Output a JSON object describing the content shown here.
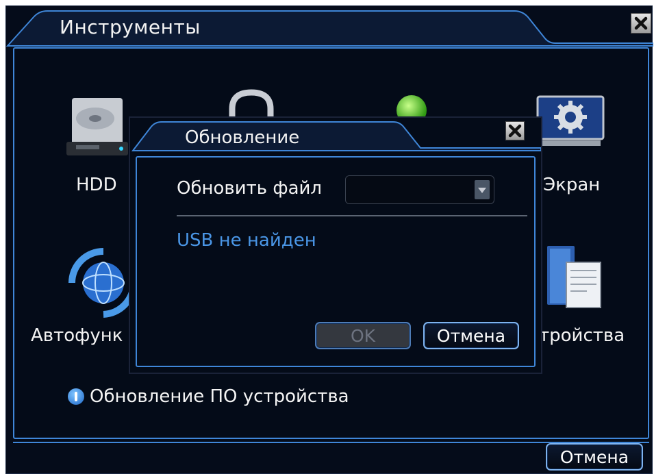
{
  "window": {
    "title": "Инструменты",
    "close_icon": "close-icon"
  },
  "tools": [
    {
      "label": "HDD",
      "icon": "hdd-icon"
    },
    {
      "label": "",
      "icon": "lock-icon"
    },
    {
      "label": "",
      "icon": "green-indicator-icon"
    },
    {
      "label": "Экран",
      "icon": "monitor-gear-icon"
    },
    {
      "label": "Автофунк",
      "icon": "globe-refresh-icon"
    },
    {
      "label": "тройства",
      "icon": "server-document-icon"
    }
  ],
  "status": {
    "icon": "info-icon",
    "text": "Обновление ПО устройства"
  },
  "footer": {
    "cancel_label": "Отмена"
  },
  "dialog": {
    "title": "Обновление",
    "close_icon": "close-icon",
    "file_label": "Обновить файл",
    "file_select_value": "",
    "usb_status": "USB не найден",
    "ok_label": "OK",
    "cancel_label": "Отмена"
  },
  "colors": {
    "background": "#050c1a",
    "accent_blue": "#3f86d8",
    "status_blue": "#4a96e6"
  }
}
